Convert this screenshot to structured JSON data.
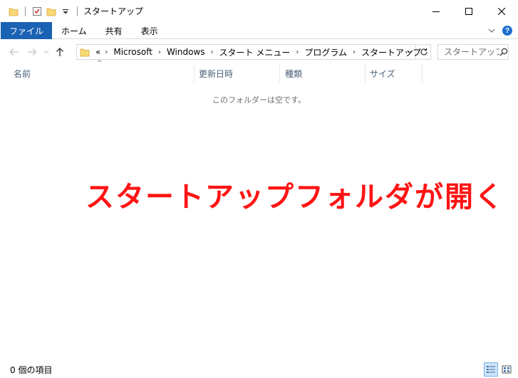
{
  "window": {
    "title": "スタートアップ"
  },
  "window_controls": {
    "minimize": "—",
    "maximize": "☐",
    "close": "✕"
  },
  "ribbon": {
    "tabs": [
      {
        "label": "ファイル"
      },
      {
        "label": "ホーム"
      },
      {
        "label": "共有"
      },
      {
        "label": "表示"
      }
    ],
    "help": "?"
  },
  "address": {
    "overflow": "«",
    "crumbs": [
      "Microsoft",
      "Windows",
      "スタート メニュー",
      "プログラム",
      "スタートアップ"
    ]
  },
  "search": {
    "placeholder": "スタートアップ..."
  },
  "columns": [
    {
      "label": "名前"
    },
    {
      "label": "更新日時"
    },
    {
      "label": "種類"
    },
    {
      "label": "サイズ"
    }
  ],
  "empty_message": "このフォルダーは空です。",
  "overlay_text": "スタートアップフォルダが開く",
  "status": {
    "item_count": "0 個の項目"
  },
  "colors": {
    "accent": "#1a62b3",
    "overlay": "#ff1414",
    "folder": "#f8d775"
  }
}
